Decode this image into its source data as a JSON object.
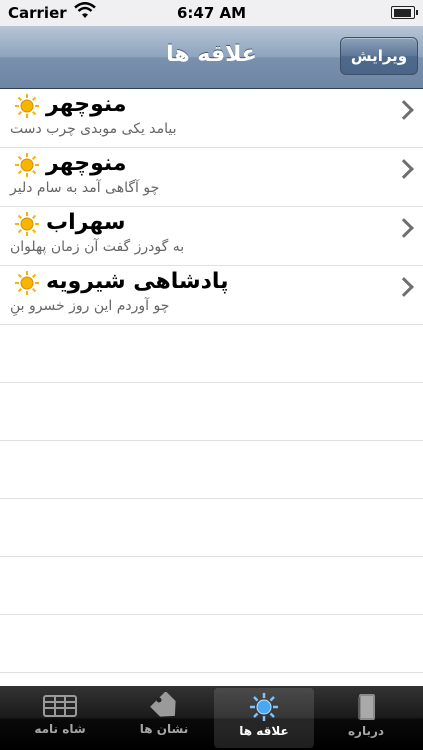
{
  "status_bar": {
    "carrier": "Carrier",
    "time": "6:47 AM",
    "battery_level": 0.9
  },
  "nav": {
    "title": "علاقه ها",
    "edit_label": "ویرایش"
  },
  "favorites": [
    {
      "title": "منوچهر",
      "subtitle": "بیامد یکی موبدی چرب دست"
    },
    {
      "title": "منوچهر",
      "subtitle": "چو آگاهی آمد به سام دلیر"
    },
    {
      "title": "سهراب",
      "subtitle": "به گودرز گفت آن زمان پهلوان"
    },
    {
      "title": "پادشاهی شیرویه",
      "subtitle": "چو آوردم این روز خسرو بنِ"
    }
  ],
  "tabs": [
    {
      "label": "شاه نامه",
      "icon": "book-grid-icon"
    },
    {
      "label": "نشان ها",
      "icon": "tag-icon"
    },
    {
      "label": "علاقه ها",
      "icon": "sun-icon",
      "selected": true
    },
    {
      "label": "درباره",
      "icon": "book-icon"
    }
  ],
  "colors": {
    "accent": "#4b6589",
    "sun": "#f7b500"
  }
}
